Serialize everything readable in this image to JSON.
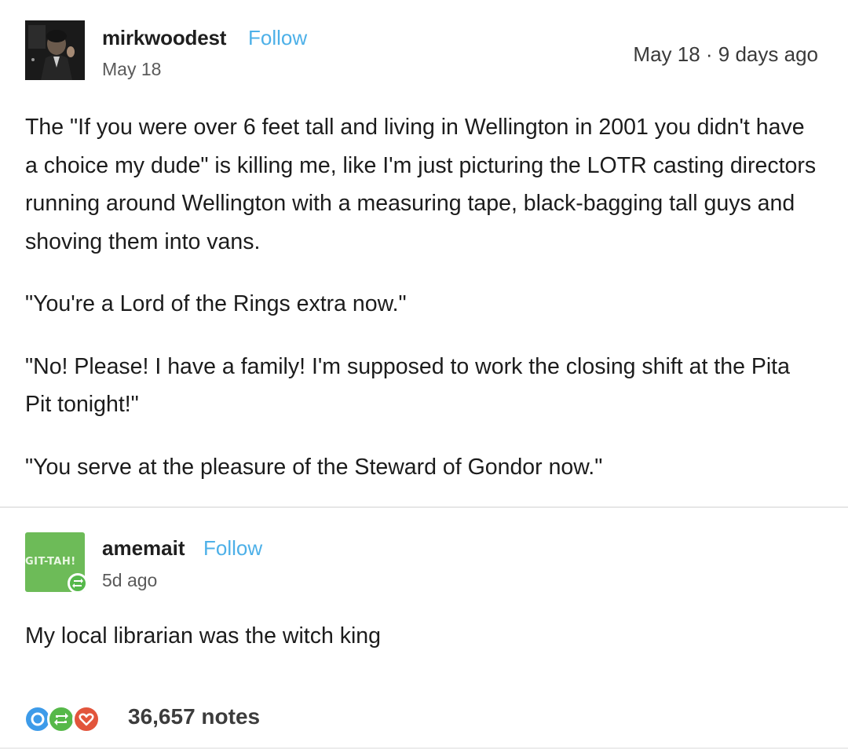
{
  "post1": {
    "username": "mirkwoodest",
    "follow_label": "Follow",
    "date": "May 18",
    "timestamp": "May 18 · 9 days ago",
    "paragraphs": [
      "The \"If you were over 6 feet tall and living in Wellington in 2001 you didn't have a choice my dude\" is killing me, like I'm just picturing the LOTR casting directors running around Wellington with a measuring tape, black-bagging tall guys and shoving them into vans.",
      "\"You're a Lord of the Rings extra now.\"",
      "\"No! Please! I have a family! I'm supposed to work the closing shift at the Pita Pit tonight!\"",
      "\"You serve at the pleasure of the Steward of Gondor now.\""
    ]
  },
  "post2": {
    "username": "amemait",
    "follow_label": "Follow",
    "avatar_text": "GIT-TAH!",
    "date": "5d ago",
    "text": "My local librarian was the witch king"
  },
  "footer": {
    "notes": "36,657 notes",
    "note_icons": [
      "comment-icon",
      "reblog-icon",
      "heart-icon"
    ],
    "colors": {
      "comment": "#3d9be9",
      "reblog": "#56b849",
      "heart": "#e2553c"
    }
  },
  "colors": {
    "follow": "#4db0e8",
    "avatar2_bg": "#6dbb58"
  }
}
